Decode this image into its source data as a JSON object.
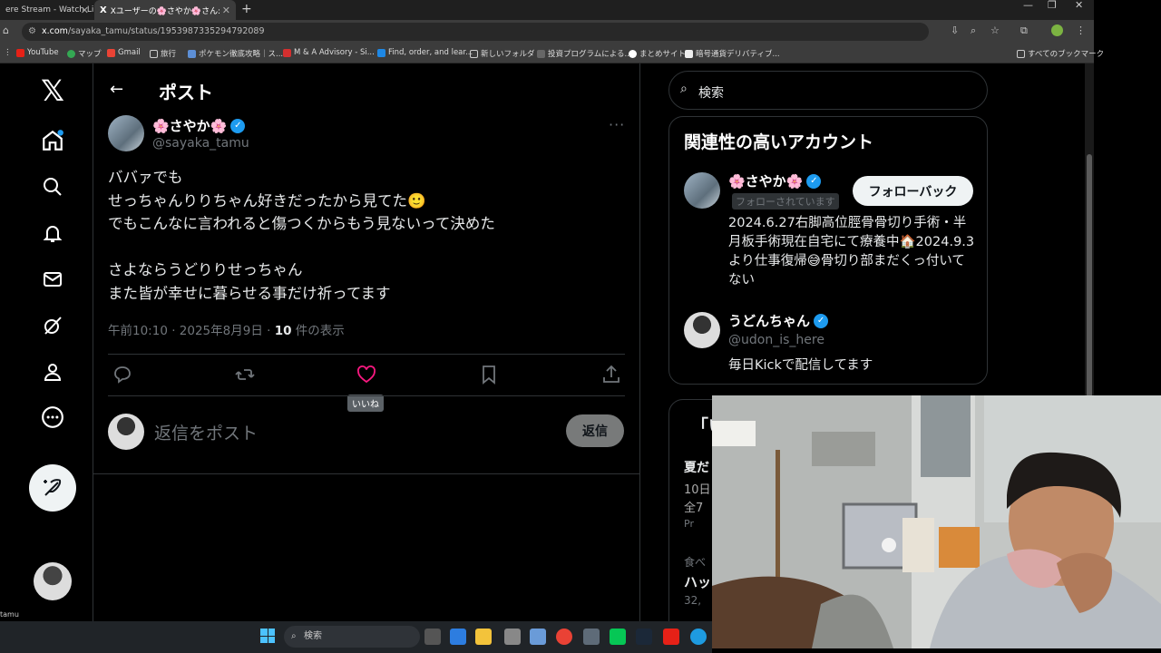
{
  "browser": {
    "tabs": [
      {
        "label": "ere Stream - Watch Li"
      },
      {
        "label": "Xユーザーの🌸さやか🌸さん:「@u"
      }
    ],
    "url_domain": "x.com",
    "url_path": "/sayaka_tamu/status/1953987335294792089",
    "bookmarks": [
      "YouTube",
      "マップ",
      "Gmail",
      "旅行",
      "ポケモン徹底攻略｜ス...",
      "M & A Advisory - Si...",
      "Find, order, and lear...",
      "新しいフォルダ",
      "投資プログラムによる...",
      "まとめサイト",
      "暗号通貨デリバティブ...",
      "すべてのブックマーク"
    ]
  },
  "header": {
    "title": "ポスト"
  },
  "post": {
    "display_name": "🌸さやか🌸",
    "handle": "@sayaka_tamu",
    "body": "ババァでも\nせっちゃんりりちゃん好きだったから見てた🙂\nでもこんなに言われると傷つくからもう見ないって決めた\n\nさよならうどりりせっちゃん\nまた皆が幸せに暮らせる事だけ祈ってます",
    "time": "午前10:10 · 2025年8月9日 · ",
    "views_count": "10",
    "views_label": " 件の表示",
    "like_tooltip": "いいね"
  },
  "reply": {
    "placeholder": "返信をポスト",
    "button": "返信"
  },
  "sidebar": {
    "search_placeholder": "検索",
    "related_title": "関連性の高いアカウント",
    "accounts": [
      {
        "name": "🌸さやか🌸",
        "follows_you": "フォローされています",
        "button": "フォローバック",
        "bio": "2024.6.27右脚高位脛骨骨切り手術・半月板手術現在自宅にて療養中🏠2024.9.3より仕事復帰😅骨切り部まだくっ付いてない"
      },
      {
        "name": "うどんちゃん",
        "handle": "@udon_is_here",
        "bio": "毎日Kickで配信してます"
      }
    ],
    "trend_fragments": [
      "「い",
      "夏だ",
      "10日",
      "全7",
      "Pr",
      "食べ",
      "ハッ",
      "32,"
    ]
  },
  "taskbar": {
    "search_label": "検索"
  },
  "misc": {
    "bottom_left_text": "tamu"
  },
  "colors": {
    "accent": "#1d9bf0",
    "like": "#f91880",
    "bg": "#000000"
  }
}
